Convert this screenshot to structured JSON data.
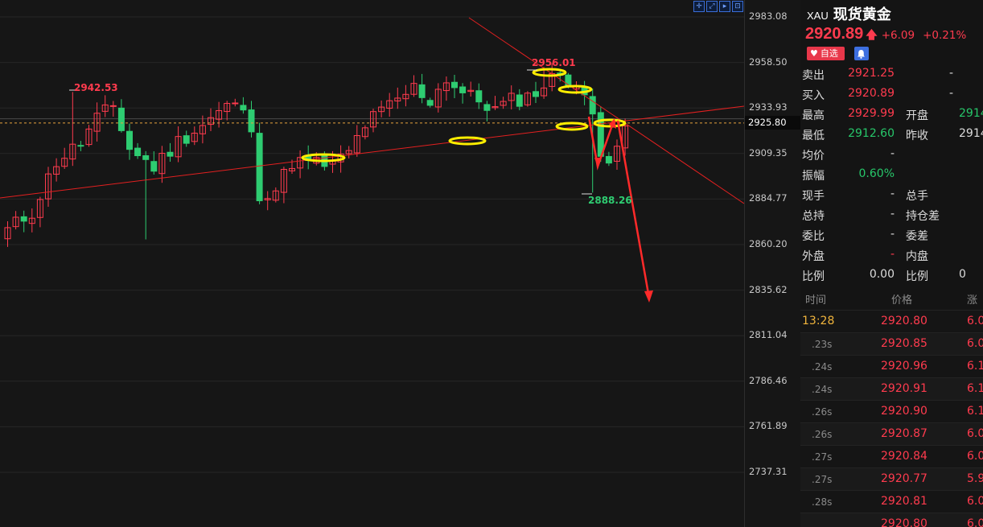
{
  "chart": {
    "toolbar_icons": [
      "crosshair-icon",
      "fullscreen-icon",
      "play-icon",
      "zoom-icon"
    ],
    "y_axis_labels": [
      "2983.08",
      "2958.50",
      "2933.93",
      "2909.35",
      "2884.77",
      "2860.20",
      "2835.62",
      "2811.04",
      "2786.46",
      "2761.89",
      "2737.31"
    ],
    "current_price_label": "2925.80",
    "annotations": {
      "high_left": "2942.53",
      "high_right": "2956.01",
      "low_right": "2888.26"
    },
    "colors": {
      "up": "#ff3b4e",
      "down": "#2ecc71",
      "trendline": "#e32020",
      "marker": "#ffee00",
      "current_line": "#e8a33c"
    }
  },
  "quote": {
    "symbol_code": "XAU",
    "symbol_name": "现货黄金",
    "price": "2920.89",
    "change": "+6.09",
    "change_pct": "+0.21%",
    "fav_label": "自选",
    "rows": [
      {
        "label": "卖出",
        "value": "2921.25",
        "value_class": "red",
        "label2": "",
        "value2": "-",
        "value2_class": "white"
      },
      {
        "label": "买入",
        "value": "2920.89",
        "value_class": "red",
        "label2": "",
        "value2": "-",
        "value2_class": "white"
      },
      {
        "label": "最高",
        "value": "2929.99",
        "value_class": "red",
        "label2": "开盘",
        "value2": "2914",
        "value2_class": "green"
      },
      {
        "label": "最低",
        "value": "2912.60",
        "value_class": "green",
        "label2": "昨收",
        "value2": "2914",
        "value2_class": "white"
      },
      {
        "label": "均价",
        "value": "-",
        "value_class": "white",
        "label2": "",
        "value2": "",
        "value2_class": "white"
      },
      {
        "label": "振幅",
        "value": "0.60%",
        "value_class": "green",
        "label2": "",
        "value2": "",
        "value2_class": "white"
      },
      {
        "label": "现手",
        "value": "-",
        "value_class": "white",
        "label2": "总手",
        "value2": "",
        "value2_class": "white"
      },
      {
        "label": "总持",
        "value": "-",
        "value_class": "white",
        "label2": "持仓差",
        "value2": "",
        "value2_class": "white"
      },
      {
        "label": "委比",
        "value": "-",
        "value_class": "white",
        "label2": "委差",
        "value2": "",
        "value2_class": "white"
      },
      {
        "label": "外盘",
        "value": "-",
        "value_class": "red",
        "label2": "内盘",
        "value2": "",
        "value2_class": "white"
      },
      {
        "label": "比例",
        "value": "0.00",
        "value_class": "white",
        "label2": "比例",
        "value2": "0",
        "value2_class": "white"
      }
    ]
  },
  "ticks": {
    "header_time": "时间",
    "header_price": "价格",
    "header_vol": "涨",
    "rows": [
      {
        "time": "13:28",
        "price": "2920.80",
        "vol": "6.0"
      },
      {
        "time": ".23s",
        "price": "2920.85",
        "vol": "6.0"
      },
      {
        "time": ".24s",
        "price": "2920.96",
        "vol": "6.1"
      },
      {
        "time": ".24s",
        "price": "2920.91",
        "vol": "6.1"
      },
      {
        "time": ".26s",
        "price": "2920.90",
        "vol": "6.1"
      },
      {
        "time": ".26s",
        "price": "2920.87",
        "vol": "6.0"
      },
      {
        "time": ".27s",
        "price": "2920.84",
        "vol": "6.0"
      },
      {
        "time": ".27s",
        "price": "2920.77",
        "vol": "5.9"
      },
      {
        "time": ".28s",
        "price": "2920.81",
        "vol": "6.0"
      },
      {
        "time": "",
        "price": "2920.80",
        "vol": "6.0"
      }
    ]
  }
}
